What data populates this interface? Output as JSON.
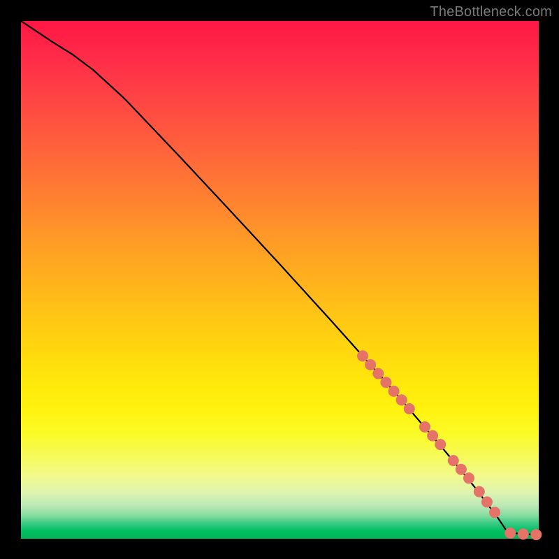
{
  "watermark": "TheBottleneck.com",
  "chart_data": {
    "type": "line",
    "title": "",
    "xlabel": "",
    "ylabel": "",
    "xlim": [
      0,
      100
    ],
    "ylim": [
      0,
      100
    ],
    "grid": false,
    "legend": null,
    "series": [
      {
        "name": "curve",
        "style": "line",
        "color": "#000000",
        "x": [
          0,
          3,
          6,
          10,
          14,
          20,
          30,
          40,
          50,
          60,
          66,
          70,
          74,
          78,
          82,
          85,
          88,
          90,
          92,
          94,
          97,
          100
        ],
        "y": [
          100,
          98,
          96,
          93.5,
          90.5,
          85,
          74.5,
          63.8,
          53.0,
          42.0,
          35.3,
          30.8,
          26.2,
          21.5,
          16.8,
          13.2,
          9.5,
          6.8,
          4.2,
          1.2,
          0.9,
          0.8
        ]
      },
      {
        "name": "markers",
        "style": "points",
        "color": "#e57368",
        "radius_px": 8,
        "x": [
          66.0,
          67.5,
          69.0,
          70.5,
          72.0,
          73.5,
          75.0,
          78.0,
          79.5,
          81.0,
          83.5,
          85.0,
          86.5,
          88.5,
          90.0,
          91.5,
          94.5,
          97.0,
          99.5
        ],
        "y": [
          35.3,
          33.6,
          31.9,
          30.2,
          28.5,
          26.8,
          25.1,
          21.6,
          19.9,
          18.2,
          15.1,
          13.4,
          11.7,
          9.1,
          7.1,
          5.1,
          1.1,
          0.9,
          0.8
        ]
      }
    ]
  },
  "colors": {
    "background": "#000000",
    "curve": "#000000",
    "marker": "#e57368",
    "watermark": "#7a7a7a"
  }
}
